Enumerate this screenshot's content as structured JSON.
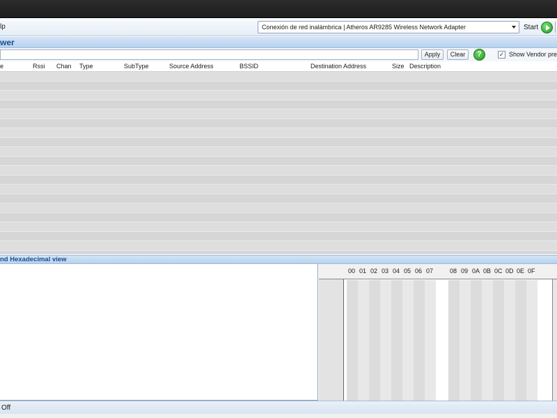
{
  "toolbar": {
    "menu_help": "lp",
    "adapter": "Conexión de red inalámbrica | Atheros AR9285 Wireless Network Adapter",
    "start_label": "Start"
  },
  "viewer": {
    "title": "wer"
  },
  "filter": {
    "value": "",
    "apply_label": "Apply",
    "clear_label": "Clear",
    "help_symbol": "?",
    "vendor_check": "✓",
    "vendor_label": "Show Vendor pref"
  },
  "columns": [
    "e",
    "Rssi",
    "Chan",
    "Type",
    "SubType",
    "Source Address",
    "BSSID",
    "Destination Address",
    "Size",
    "Description"
  ],
  "hex_view": {
    "title": "nd Hexadecimal view",
    "headers_left": [
      "00",
      "01",
      "02",
      "03",
      "04",
      "05",
      "06",
      "07"
    ],
    "headers_right": [
      "08",
      "09",
      "0A",
      "0B",
      "0C",
      "0D",
      "0E",
      "0F"
    ]
  },
  "status": {
    "text": "Off"
  },
  "colors": {
    "accent": "#1b4d8e",
    "header_bg": "#c4daf2",
    "start_green": "#1f9b22"
  }
}
